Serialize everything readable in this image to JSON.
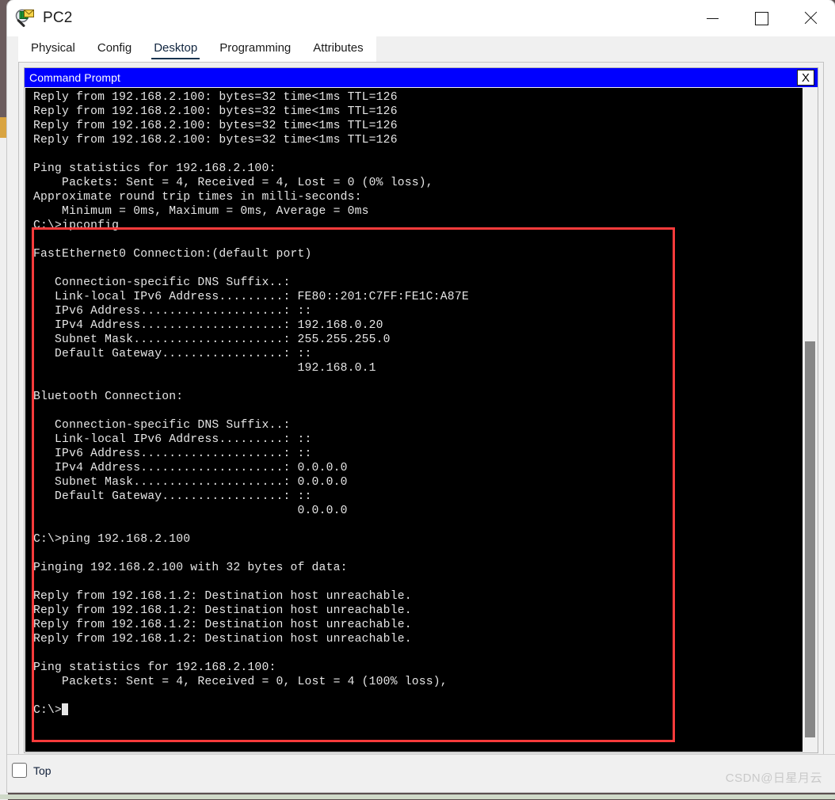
{
  "window": {
    "title": "PC2",
    "icon": "packet-tracer-icon",
    "controls": {
      "minimize": "—",
      "maximize": "□",
      "close": "✕"
    }
  },
  "tabs": [
    {
      "label": "Physical",
      "active": false
    },
    {
      "label": "Config",
      "active": false
    },
    {
      "label": "Desktop",
      "active": true
    },
    {
      "label": "Programming",
      "active": false
    },
    {
      "label": "Attributes",
      "active": false
    }
  ],
  "command_prompt": {
    "title": "Command Prompt",
    "close_label": "X",
    "terminal_text_top": "Reply from 192.168.2.100: bytes=32 time<1ms TTL=126\nReply from 192.168.2.100: bytes=32 time<1ms TTL=126\nReply from 192.168.2.100: bytes=32 time<1ms TTL=126\nReply from 192.168.2.100: bytes=32 time<1ms TTL=126\n\nPing statistics for 192.168.2.100:\n    Packets: Sent = 4, Received = 4, Lost = 0 (0% loss),\nApproximate round trip times in milli-seconds:\n    Minimum = 0ms, Maximum = 0ms, Average = 0ms\n",
    "terminal_text_boxed": "C:\\>ipconfig\n\nFastEthernet0 Connection:(default port)\n\n   Connection-specific DNS Suffix..:\n   Link-local IPv6 Address.........: FE80::201:C7FF:FE1C:A87E\n   IPv6 Address....................: ::\n   IPv4 Address....................: 192.168.0.20\n   Subnet Mask.....................: 255.255.255.0\n   Default Gateway.................: ::\n                                     192.168.0.1\n\nBluetooth Connection:\n\n   Connection-specific DNS Suffix..:\n   Link-local IPv6 Address.........: ::\n   IPv6 Address....................: ::\n   IPv4 Address....................: 0.0.0.0\n   Subnet Mask.....................: 0.0.0.0\n   Default Gateway.................: ::\n                                     0.0.0.0\n\nC:\\>ping 192.168.2.100\n\nPinging 192.168.2.100 with 32 bytes of data:\n\nReply from 192.168.1.2: Destination host unreachable.\nReply from 192.168.1.2: Destination host unreachable.\nReply from 192.168.1.2: Destination host unreachable.\nReply from 192.168.1.2: Destination host unreachable.\n\nPing statistics for 192.168.2.100:\n    Packets: Sent = 4, Received = 0, Lost = 4 (100% loss),\n\nC:\\>",
    "colors": {
      "titlebar": "#0000ff",
      "terminal_bg": "#000000",
      "terminal_fg": "#e6e6e6",
      "annotation_box": "#fb3b3b"
    }
  },
  "footer": {
    "top_checkbox_label": "Top",
    "top_checkbox_checked": false,
    "watermark": "CSDN@日星月云"
  }
}
